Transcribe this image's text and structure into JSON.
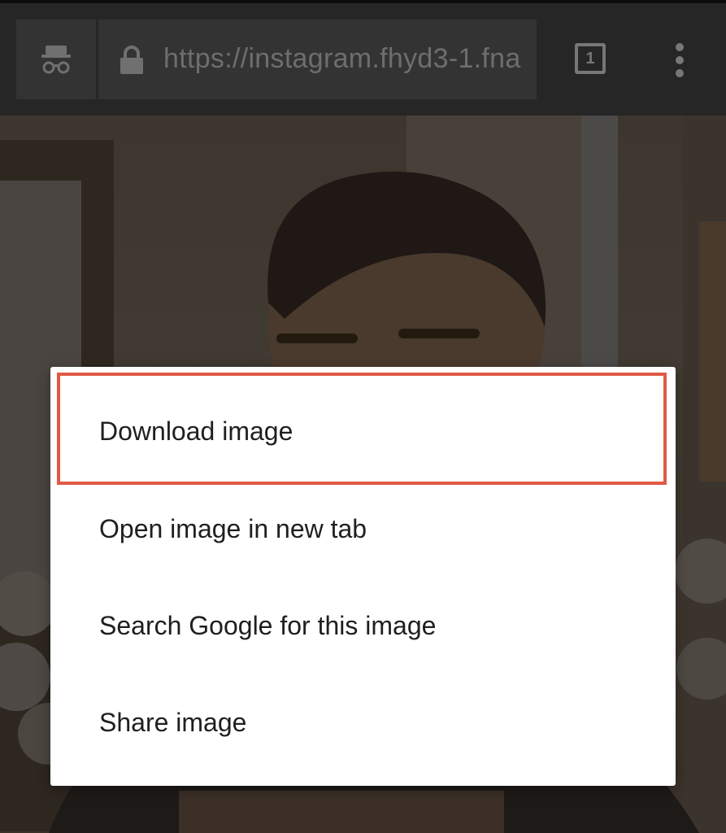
{
  "browser": {
    "url": "https://instagram.fhyd3-1.fna",
    "tab_count": "1",
    "icons": {
      "incognito": "incognito-icon",
      "lock": "lock-icon",
      "tabs": "tab-switcher-icon",
      "menu": "more-vert-icon"
    }
  },
  "context_menu": {
    "items": [
      {
        "label": "Download image"
      },
      {
        "label": "Open image in new tab"
      },
      {
        "label": "Search Google for this image"
      },
      {
        "label": "Share image"
      }
    ],
    "highlight_color": "#e05a44"
  },
  "colors": {
    "toolbar": "#262626",
    "omnibox": "#333333",
    "menu_bg": "#ffffff",
    "menu_text": "#1f1f1f"
  }
}
